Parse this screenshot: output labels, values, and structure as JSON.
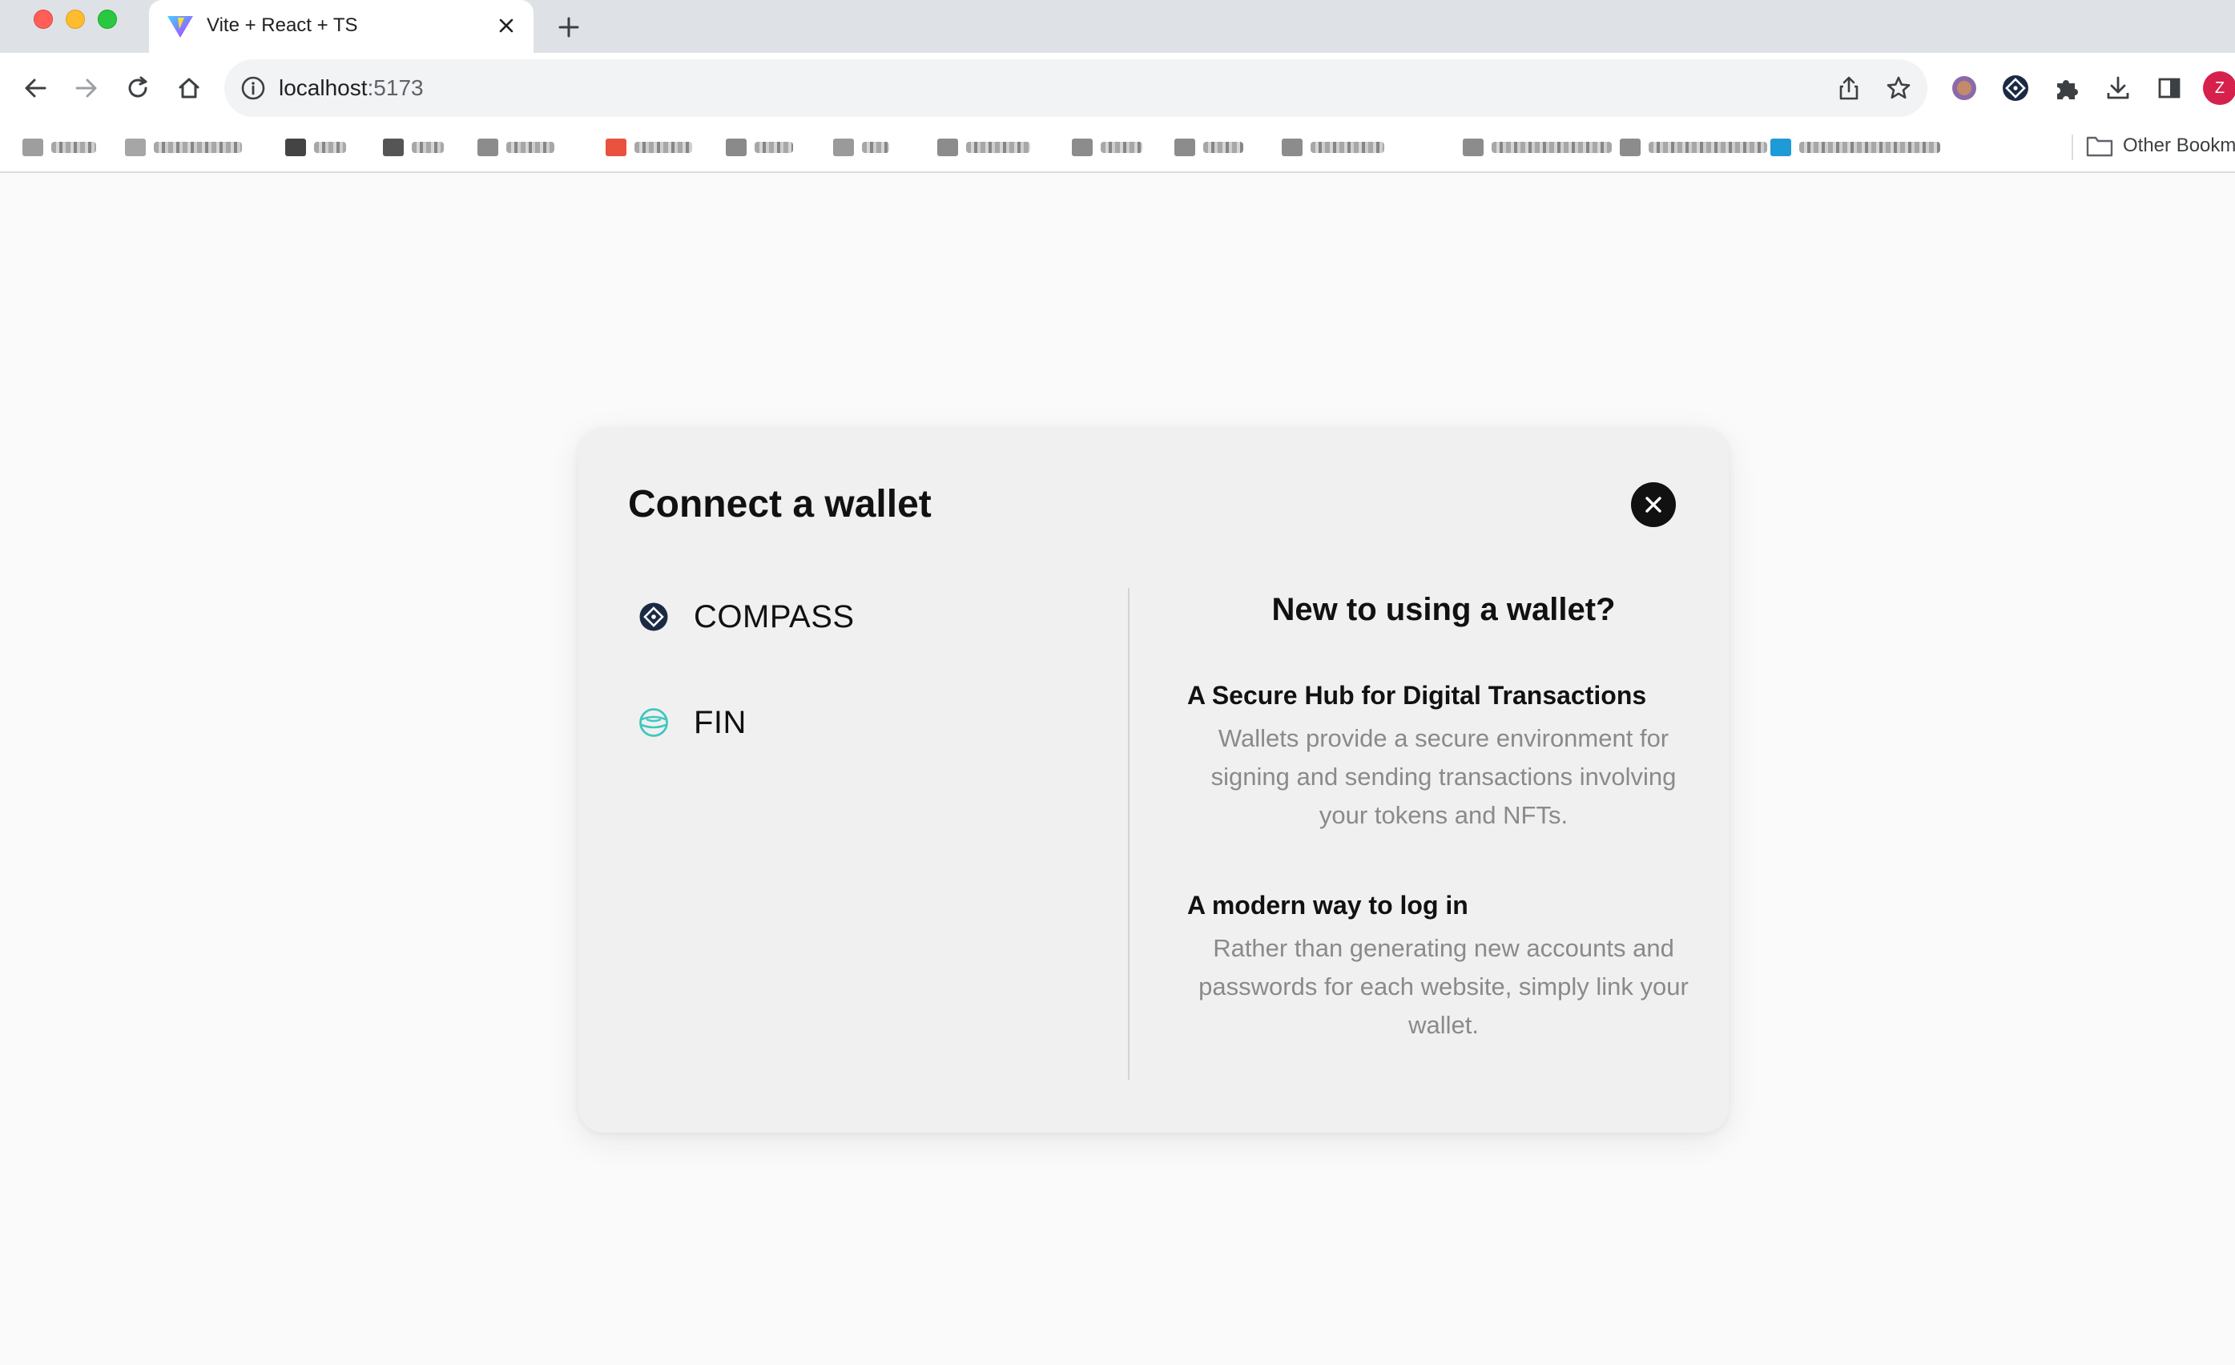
{
  "browser": {
    "tab_title": "Vite + React + TS",
    "url_host": "localhost",
    "url_port": ":5173",
    "profile_initial": "Z",
    "other_bookmarks_label": "Other Bookmarks"
  },
  "modal": {
    "title": "Connect a wallet",
    "wallets": [
      {
        "label": "COMPASS",
        "icon": "compass-icon"
      },
      {
        "label": "FIN",
        "icon": "fin-icon"
      }
    ],
    "help": {
      "title": "New to using a wallet?",
      "sections": [
        {
          "heading": "A Secure Hub for Digital Transactions",
          "body": "Wallets provide a secure environment for signing and sending transactions involving your tokens and NFTs."
        },
        {
          "heading": "A modern way to log in",
          "body": "Rather than generating new accounts and passwords for each website, simply link your wallet."
        }
      ]
    }
  },
  "colors": {
    "page_bg": "#fafafa",
    "modal_bg": "#f0f0f0",
    "close_bg": "#111111",
    "compass_icon": "#1b2a44",
    "fin_icon": "#3ec7c0",
    "muted_text": "#8a8a8a"
  }
}
